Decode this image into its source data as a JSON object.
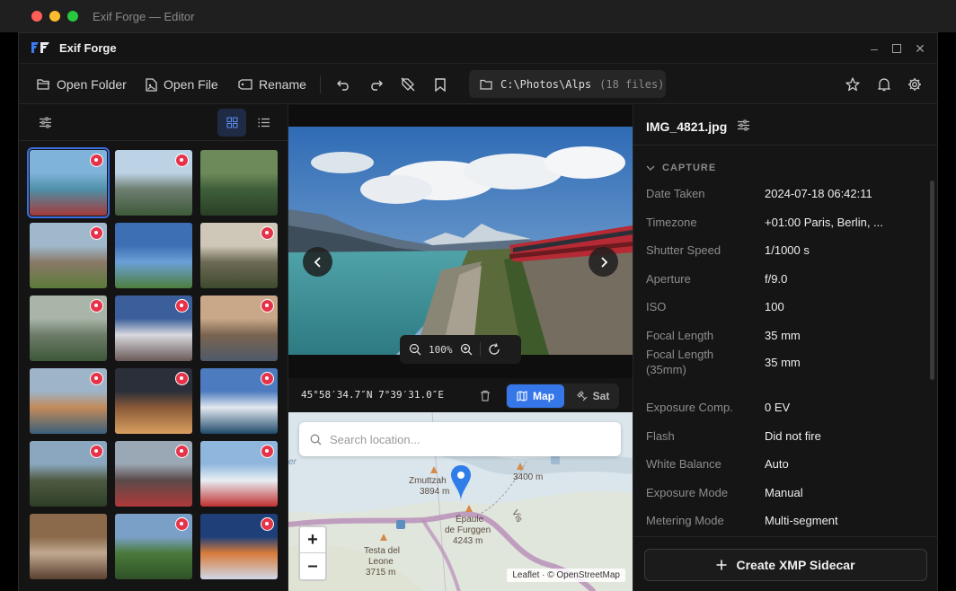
{
  "window": {
    "title": "Exif Forge — Editor"
  },
  "app": {
    "name": "Exif Forge"
  },
  "toolbar": {
    "open_folder": "Open Folder",
    "open_file": "Open File",
    "rename": "Rename",
    "path": "C:\\Photos\\Alps",
    "file_count": "(18 files)"
  },
  "thumbnails": [
    {
      "id": "t1",
      "colors": [
        "#7fb3d9",
        "#4f8fa8",
        "#a33a3a"
      ],
      "geotagged": true,
      "selected": true
    },
    {
      "id": "t2",
      "colors": [
        "#bcd3e6",
        "#6e7e70",
        "#3e5a3a"
      ],
      "geotagged": true
    },
    {
      "id": "t3",
      "colors": [
        "#6d8a5a",
        "#3f5f3a",
        "#2a3f25"
      ],
      "geotagged": false
    },
    {
      "id": "t4",
      "colors": [
        "#9fb8cc",
        "#8a7a68",
        "#5c7a3a"
      ],
      "geotagged": true
    },
    {
      "id": "t5",
      "colors": [
        "#3d6fb5",
        "#6aa0d6",
        "#4e7e3e"
      ],
      "geotagged": false
    },
    {
      "id": "t6",
      "colors": [
        "#cfc8b8",
        "#6e6a55",
        "#3e4a2e"
      ],
      "geotagged": true
    },
    {
      "id": "t7",
      "colors": [
        "#a9b5a8",
        "#6d7c6a",
        "#3d5838"
      ],
      "geotagged": true
    },
    {
      "id": "t8",
      "colors": [
        "#3a5f9a",
        "#d8d8de",
        "#6a5a58"
      ],
      "geotagged": true
    },
    {
      "id": "t9",
      "colors": [
        "#c9a889",
        "#7a6450",
        "#4e5a6a"
      ],
      "geotagged": true
    },
    {
      "id": "t10",
      "colors": [
        "#9db4c9",
        "#c28a58",
        "#3b5f7a"
      ],
      "geotagged": true
    },
    {
      "id": "t11",
      "colors": [
        "#2b2f3a",
        "#8a5a38",
        "#d9a060"
      ],
      "geotagged": true
    },
    {
      "id": "t12",
      "colors": [
        "#4c7bbf",
        "#e2e8ef",
        "#1f4a6a"
      ],
      "geotagged": true
    },
    {
      "id": "t13",
      "colors": [
        "#8aa7bf",
        "#4e5a42",
        "#2e3e26"
      ],
      "geotagged": true
    },
    {
      "id": "t14",
      "colors": [
        "#9aa7b4",
        "#5a4a48",
        "#b03a3a"
      ],
      "geotagged": true
    },
    {
      "id": "t15",
      "colors": [
        "#8fb7de",
        "#e8eef3",
        "#c03030"
      ],
      "geotagged": true
    },
    {
      "id": "t16",
      "colors": [
        "#8a6a4a",
        "#c0a890",
        "#5a4030"
      ],
      "geotagged": false
    },
    {
      "id": "t17",
      "colors": [
        "#7aa0c8",
        "#4a7a3a",
        "#2f5228"
      ],
      "geotagged": true
    },
    {
      "id": "t18",
      "colors": [
        "#1e3f78",
        "#d87a3a",
        "#cfd8e6"
      ],
      "geotagged": true
    }
  ],
  "viewer": {
    "zoom": "100%",
    "coordinates": "45°58′34.7″N 7°39′31.0″E",
    "map_toggle": "Map",
    "sat_toggle": "Sat"
  },
  "map": {
    "search_placeholder": "Search location...",
    "zoom_in": "+",
    "zoom_out": "–",
    "attribution": "Leaflet · © OpenStreetMap",
    "labels": [
      {
        "text": "Zmuttzah",
        "sub": "3894 m"
      },
      {
        "text": "3400 m",
        "sub": ""
      },
      {
        "text": "Épaule",
        "sub": "de Furggen"
      },
      {
        "text": "4243 m",
        "sub": ""
      },
      {
        "text": "Testa del",
        "sub": "Leone"
      },
      {
        "text": "3715 m",
        "sub": ""
      },
      {
        "text": "Vis",
        "sub": ""
      },
      {
        "text": "er",
        "sub": ""
      }
    ]
  },
  "inspector": {
    "filename": "IMG_4821.jpg",
    "section": "CAPTURE",
    "rows": [
      {
        "key": "Date Taken",
        "value": "2024-07-18 06:42:11"
      },
      {
        "key": "Timezone",
        "value": "+01:00 Paris, Berlin, ..."
      },
      {
        "key": "Shutter Speed",
        "value": "1/1000 s"
      },
      {
        "key": "Aperture",
        "value": "f/9.0"
      },
      {
        "key": "ISO",
        "value": "100"
      },
      {
        "key": "Focal Length",
        "value": "35 mm"
      },
      {
        "key": "Focal Length (35mm)",
        "value": "35 mm"
      },
      {
        "key": "Exposure Comp.",
        "value": "0 EV"
      },
      {
        "key": "Flash",
        "value": "Did not fire"
      },
      {
        "key": "White Balance",
        "value": "Auto"
      },
      {
        "key": "Exposure Mode",
        "value": "Manual"
      },
      {
        "key": "Metering Mode",
        "value": "Multi-segment"
      }
    ],
    "create_xmp": "Create XMP Sidecar"
  },
  "colors": {
    "accent": "#3576e8",
    "pin": "#e5344a"
  }
}
